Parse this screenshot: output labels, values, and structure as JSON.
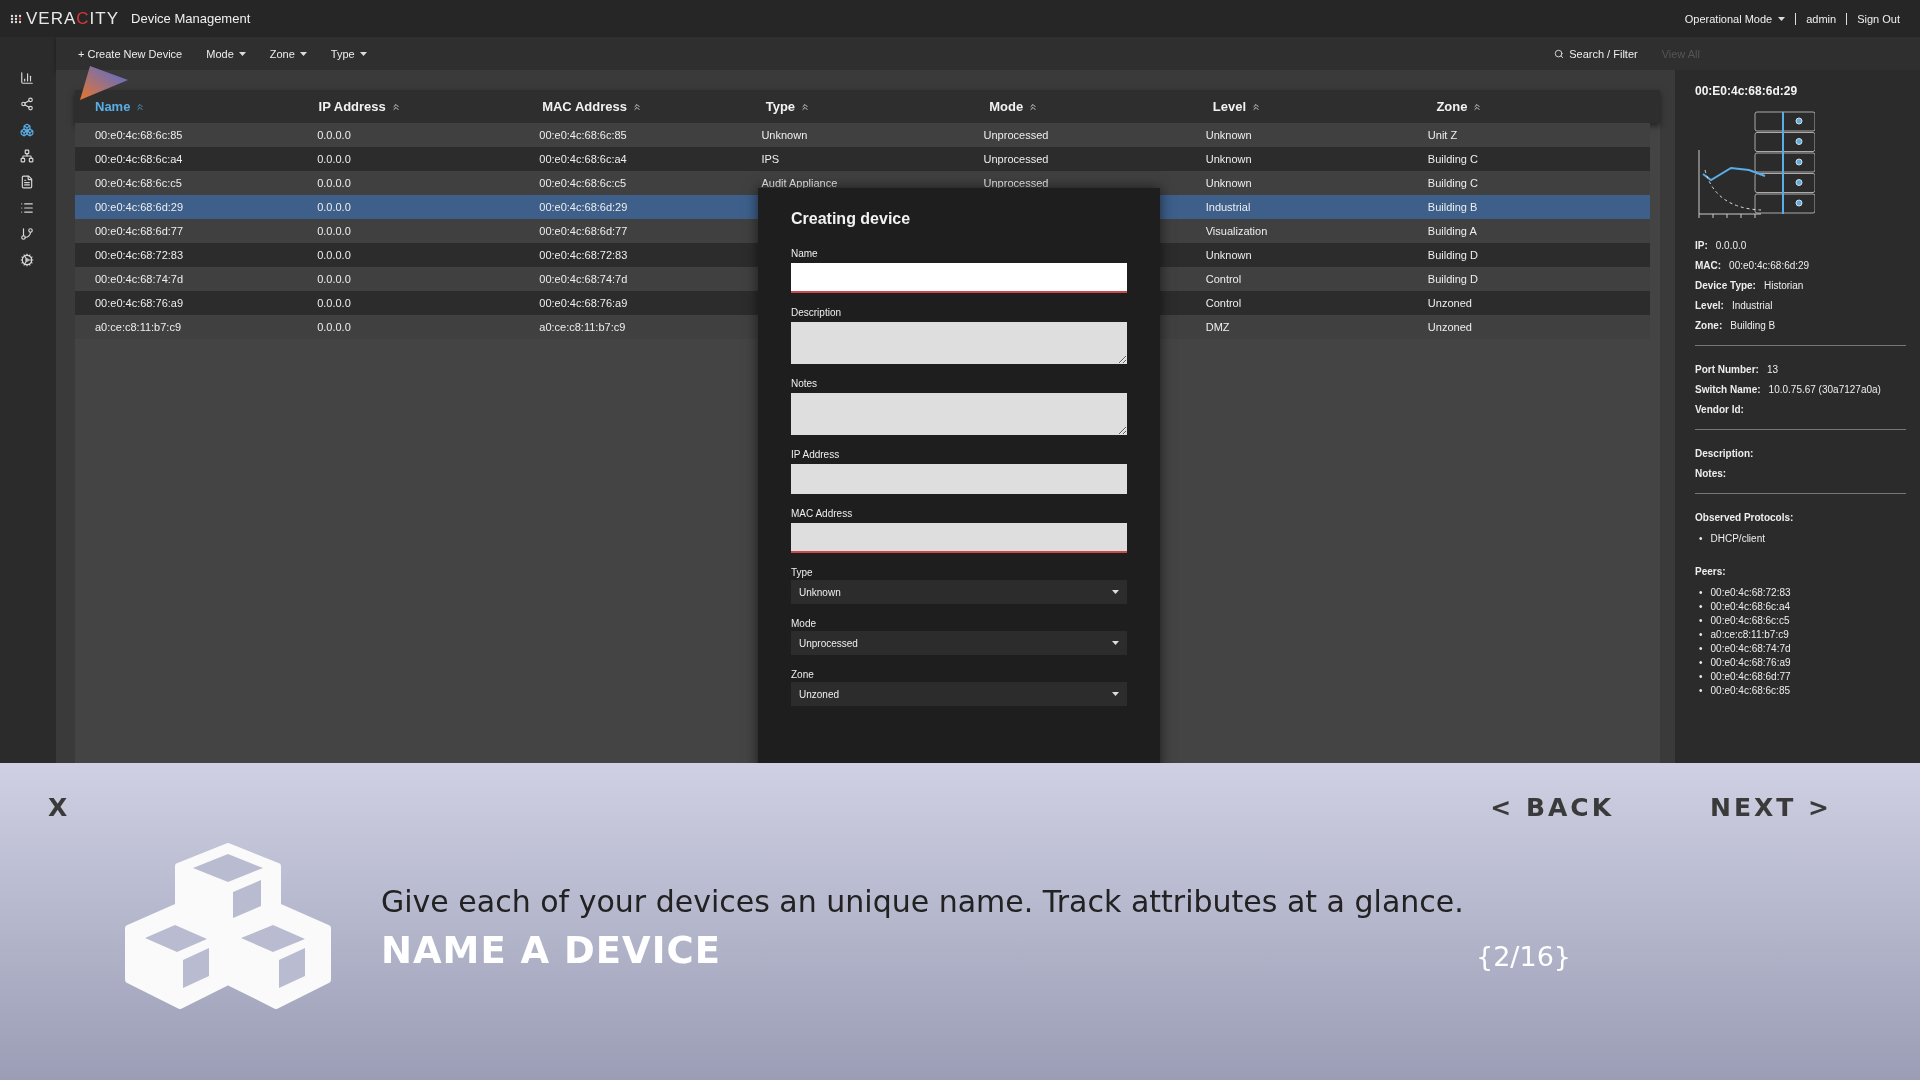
{
  "top_bar": {
    "logo": [
      {
        "text": "VERA",
        "accent": false
      },
      {
        "text": "C",
        "accent": true
      },
      {
        "text": "ITY",
        "accent": false
      }
    ],
    "title": "Device Management",
    "menu": "Operational Mode",
    "user": "admin",
    "sign_out": "Sign Out"
  },
  "rail": [
    {
      "kind": "chart",
      "selected": false
    },
    {
      "kind": "share",
      "selected": false
    },
    {
      "kind": "cubes",
      "selected": true
    },
    {
      "kind": "hierarchy",
      "selected": false
    },
    {
      "kind": "document",
      "selected": false
    },
    {
      "kind": "list",
      "selected": false
    },
    {
      "kind": "branch",
      "selected": false
    },
    {
      "kind": "gears",
      "selected": false
    }
  ],
  "toolbar": {
    "create": "+ Create New Device",
    "filters": [
      "Mode",
      "Zone",
      "Type"
    ],
    "search": "Search / Filter",
    "view_all": {
      "label": "View All",
      "disabled": true
    }
  },
  "table": {
    "columns": [
      {
        "label": "Name",
        "selected": true
      },
      {
        "label": "IP Address",
        "selected": false
      },
      {
        "label": "MAC Address",
        "selected": false
      },
      {
        "label": "Type",
        "selected": false
      },
      {
        "label": "Mode",
        "selected": false
      },
      {
        "label": "Level",
        "selected": false
      },
      {
        "label": "Zone",
        "selected": false
      }
    ],
    "rows": [
      {
        "selected": false,
        "cells": {
          "name": "00:e0:4c:68:6c:85",
          "ip": "0.0.0.0",
          "mac": "00:e0:4c:68:6c:85",
          "type": "Unknown",
          "mode": "Unprocessed",
          "level": "Unknown",
          "zone": "Unit Z"
        }
      },
      {
        "selected": false,
        "cells": {
          "name": "00:e0:4c:68:6c:a4",
          "ip": "0.0.0.0",
          "mac": "00:e0:4c:68:6c:a4",
          "type": "IPS",
          "mode": "Unprocessed",
          "level": "Unknown",
          "zone": "Building C"
        }
      },
      {
        "selected": false,
        "cells": {
          "name": "00:e0:4c:68:6c:c5",
          "ip": "0.0.0.0",
          "mac": "00:e0:4c:68:6c:c5",
          "type": "Audit Appliance",
          "mode": "Unprocessed",
          "level": "Unknown",
          "zone": "Building C"
        }
      },
      {
        "selected": true,
        "cells": {
          "name": "00:e0:4c:68:6d:29",
          "ip": "0.0.0.0",
          "mac": "00:e0:4c:68:6d:29",
          "level": "Industrial",
          "zone": "Building B"
        }
      },
      {
        "selected": false,
        "cells": {
          "name": "00:e0:4c:68:6d:77",
          "ip": "0.0.0.0",
          "mac": "00:e0:4c:68:6d:77",
          "level": "Visualization",
          "zone": "Building A"
        }
      },
      {
        "selected": false,
        "cells": {
          "name": "00:e0:4c:68:72:83",
          "ip": "0.0.0.0",
          "mac": "00:e0:4c:68:72:83",
          "level": "Unknown",
          "zone": "Building D"
        }
      },
      {
        "selected": false,
        "cells": {
          "name": "00:e0:4c:68:74:7d",
          "ip": "0.0.0.0",
          "mac": "00:e0:4c:68:74:7d",
          "level": "Control",
          "zone": "Building D"
        }
      },
      {
        "selected": false,
        "cells": {
          "name": "00:e0:4c:68:76:a9",
          "ip": "0.0.0.0",
          "mac": "00:e0:4c:68:76:a9",
          "level": "Control",
          "zone": "Unzoned"
        }
      },
      {
        "selected": false,
        "cells": {
          "name": "a0:ce:c8:11:b7:c9",
          "ip": "0.0.0.0",
          "mac": "a0:ce:c8:11:b7:c9",
          "level": "DMZ",
          "zone": "Unzoned"
        }
      }
    ]
  },
  "modal": {
    "title": "Creating device",
    "fields": [
      {
        "kind": "input",
        "label": "Name",
        "focused": true,
        "invalid": true
      },
      {
        "kind": "textarea",
        "label": "Description",
        "focused": false,
        "invalid": false
      },
      {
        "kind": "textarea",
        "label": "Notes",
        "focused": false,
        "invalid": false
      },
      {
        "kind": "input",
        "label": "IP Address",
        "focused": false,
        "invalid": false
      },
      {
        "kind": "input",
        "label": "MAC Address",
        "focused": false,
        "invalid": true
      },
      {
        "kind": "select",
        "label": "Type",
        "value": "Unknown"
      },
      {
        "kind": "select",
        "label": "Mode",
        "value": "Unprocessed"
      },
      {
        "kind": "select",
        "label": "Zone",
        "value": "Unzoned"
      }
    ]
  },
  "details": {
    "title": "00:E0:4c:68:6d:29",
    "sections": [
      [
        {
          "label": "IP:",
          "value": "0.0.0.0"
        },
        {
          "label": "MAC:",
          "value": "00:e0:4c:68:6d:29"
        },
        {
          "label": "Device Type:",
          "value": "Historian"
        },
        {
          "label": "Level:",
          "value": "Industrial"
        },
        {
          "label": "Zone:",
          "value": "Building B"
        }
      ],
      [
        {
          "label": "Port Number:",
          "value": "13"
        },
        {
          "label": "Switch Name:",
          "value": "10.0.75.67 (30a7127a0a)"
        },
        {
          "label": "Vendor Id:"
        }
      ],
      [
        {
          "label": "Description:"
        },
        {
          "label": "Notes:"
        }
      ]
    ],
    "protocols": {
      "label": "Observed Protocols:",
      "marker": "•",
      "items": [
        "DHCP/client"
      ]
    },
    "peers": {
      "label": "Peers:",
      "marker": "•",
      "items": [
        "00:e0:4c:68:72:83",
        "00:e0:4c:68:6c:a4",
        "00:e0:4c:68:6c:c5",
        "a0:ce:c8:11:b7:c9",
        "00:e0:4c:68:74:7d",
        "00:e0:4c:68:76:a9",
        "00:e0:4c:68:6d:77",
        "00:e0:4c:68:6c:85"
      ]
    }
  },
  "tour": {
    "close": "X",
    "back": "< BACK",
    "next": "NEXT >",
    "message": "Give each of your devices an unique name. Track attributes at a glance.",
    "title": "NAME A DEVICE",
    "counter": "{2/16}"
  }
}
